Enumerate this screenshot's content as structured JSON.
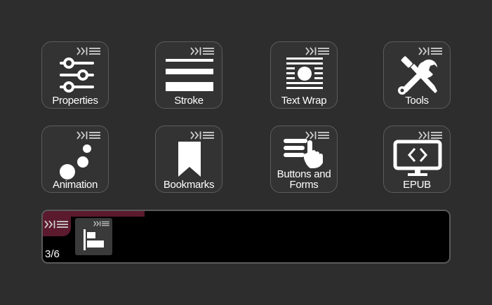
{
  "colors": {
    "background": "#2d2d2d",
    "tile_background": "#333333",
    "tile_border": "#5c5c5c",
    "accent": "#5b1a2e",
    "icon": "#ffffff",
    "panel_background": "#000000"
  },
  "tiles": [
    {
      "label": "Properties",
      "icon": "sliders-icon"
    },
    {
      "label": "Stroke",
      "icon": "stroke-lines-icon"
    },
    {
      "label": "Text Wrap",
      "icon": "text-wrap-icon"
    },
    {
      "label": "Tools",
      "icon": "wrench-screwdriver-icon"
    },
    {
      "label": "Animation",
      "icon": "animation-dots-icon"
    },
    {
      "label": "Bookmarks",
      "icon": "bookmark-icon"
    },
    {
      "label": "Buttons and\nForms",
      "icon": "hand-pointer-list-icon"
    },
    {
      "label": "EPUB",
      "icon": "monitor-code-icon"
    }
  ],
  "panel": {
    "page_indicator": "3/6",
    "progress_fraction": 0.25,
    "thumbnail_icon": "align-left-icon"
  }
}
